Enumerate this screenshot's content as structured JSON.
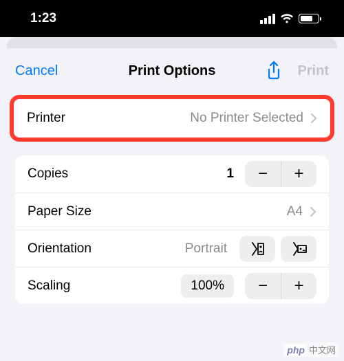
{
  "status": {
    "time": "1:23"
  },
  "nav": {
    "cancel": "Cancel",
    "title": "Print Options",
    "print": "Print"
  },
  "printer": {
    "label": "Printer",
    "value": "No Printer Selected"
  },
  "copies": {
    "label": "Copies",
    "value": "1"
  },
  "paper": {
    "label": "Paper Size",
    "value": "A4"
  },
  "orientation": {
    "label": "Orientation",
    "value": "Portrait"
  },
  "scaling": {
    "label": "Scaling",
    "value": "100%"
  },
  "watermark": {
    "brand": "php",
    "text": "中文网"
  }
}
